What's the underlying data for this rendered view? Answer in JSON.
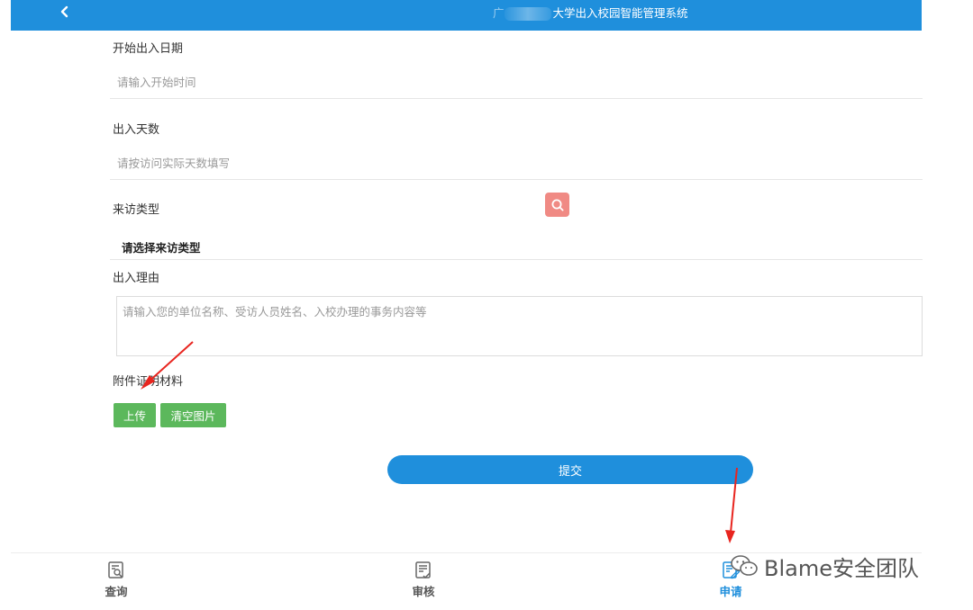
{
  "header": {
    "title": "大学出入校园智能管理系统",
    "title_prefix": "广"
  },
  "form": {
    "start_date": {
      "label": "开始出入日期",
      "placeholder": "请输入开始时间"
    },
    "days": {
      "label": "出入天数",
      "placeholder": "请按访问实际天数填写"
    },
    "visit_type": {
      "label": "来访类型",
      "value": "请选择来访类型"
    },
    "reason": {
      "label": "出入理由",
      "placeholder": "请输入您的单位名称、受访人员姓名、入校办理的事务内容等"
    },
    "attachment": {
      "label": "附件证明材料",
      "upload_label": "上传",
      "clear_label": "清空图片"
    },
    "submit_label": "提交"
  },
  "bottom_nav": [
    {
      "label": "查询",
      "icon": "search-doc-icon",
      "active": false
    },
    {
      "label": "审核",
      "icon": "review-doc-icon",
      "active": false
    },
    {
      "label": "申请",
      "icon": "apply-edit-icon",
      "active": true
    }
  ],
  "watermark": {
    "text": "Blame安全团队",
    "icon": "wechat-icon"
  },
  "colors": {
    "primary": "#1f8fdc",
    "success": "#5cb85c",
    "search_button": "#f08a84",
    "annotation_arrow": "#e8251f"
  }
}
